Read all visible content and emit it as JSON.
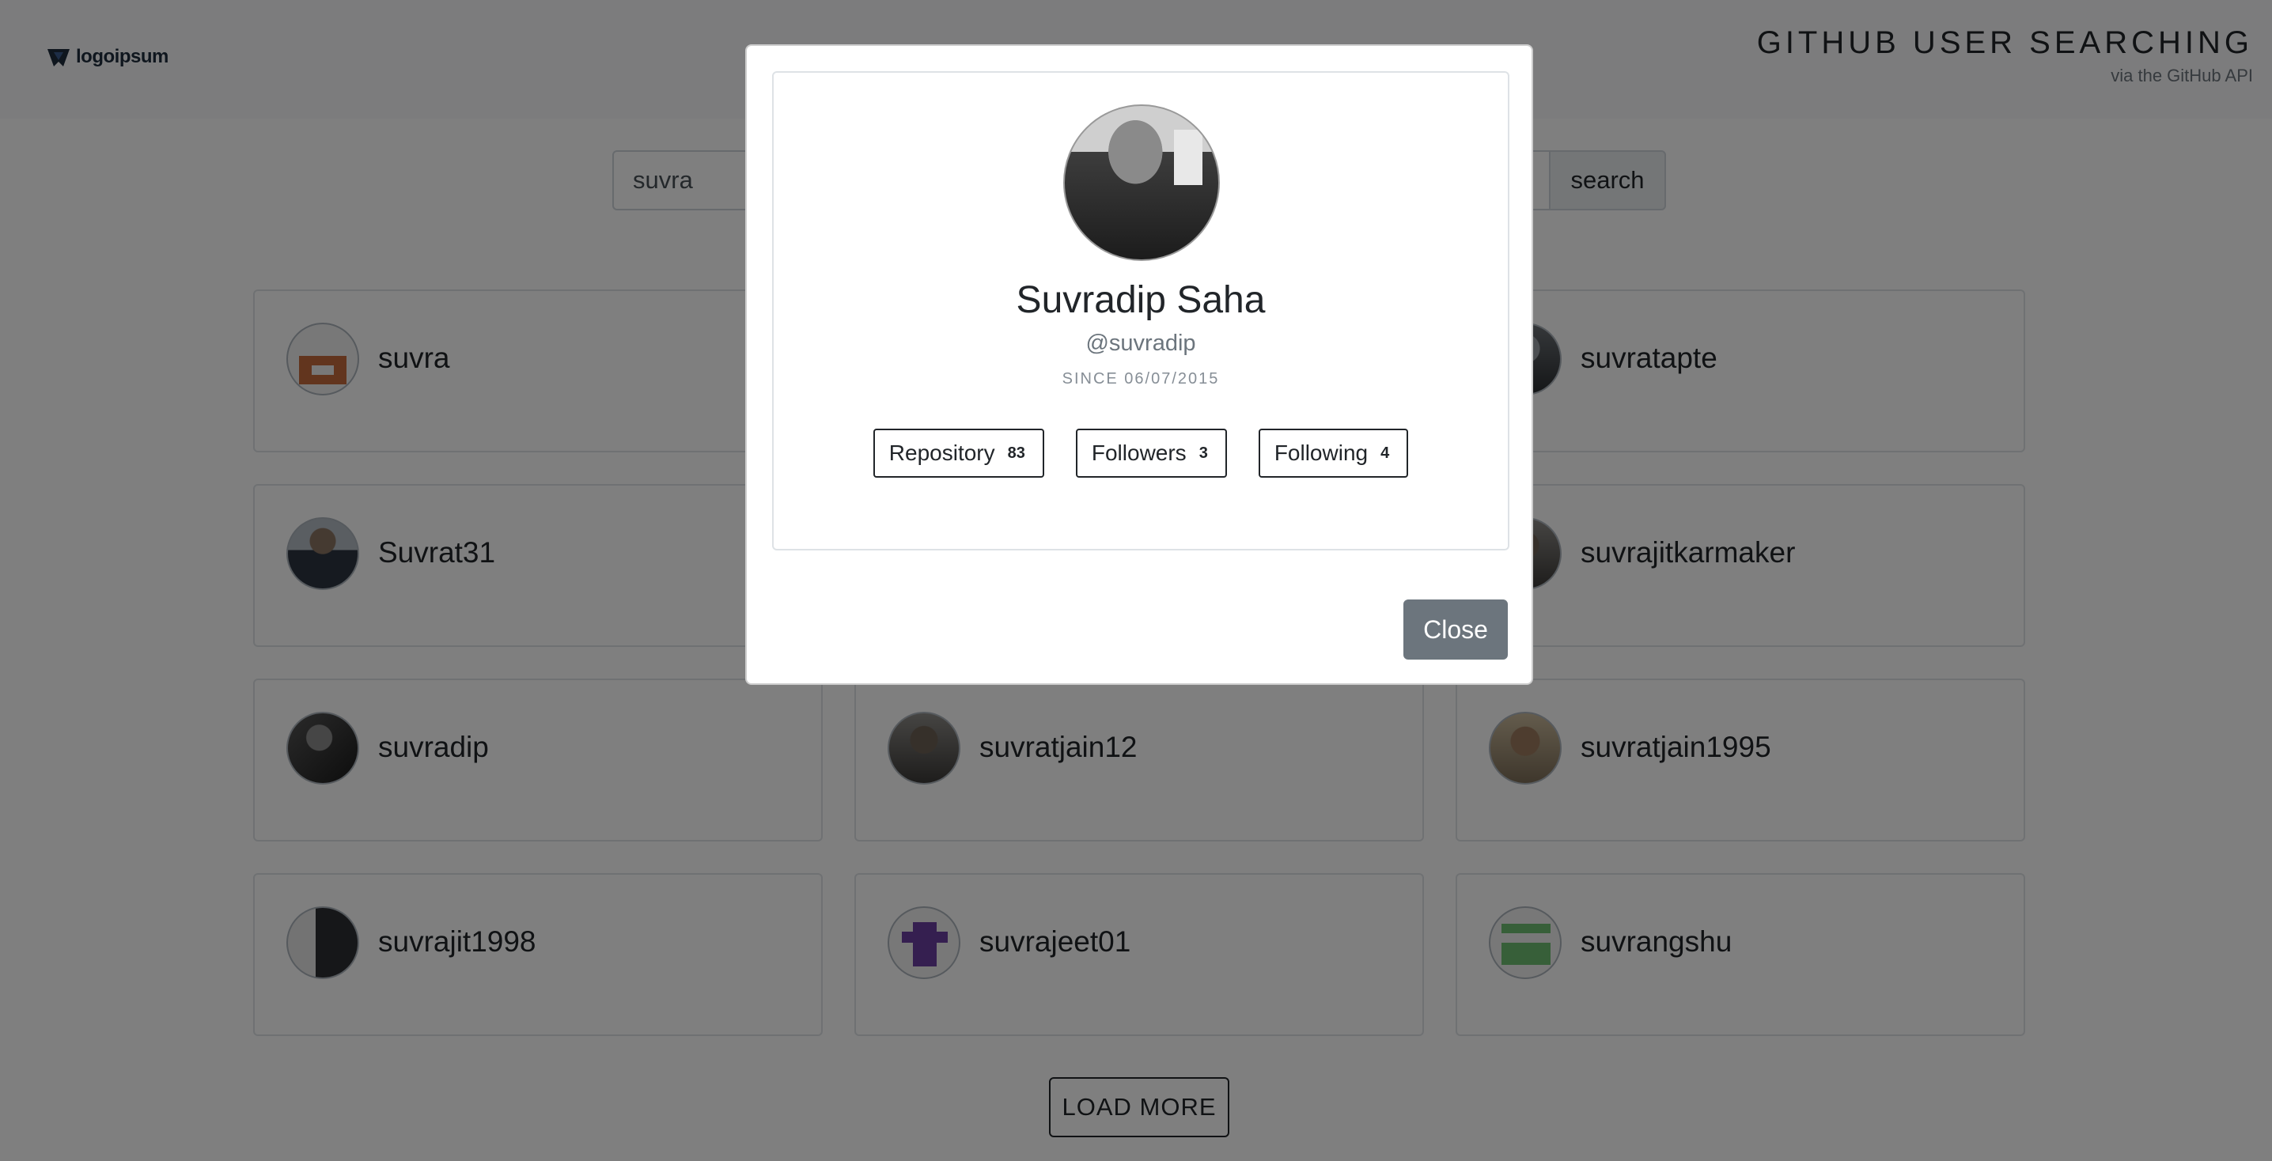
{
  "header": {
    "logo_text": "logoipsum",
    "title": "GITHUB USER SEARCHING",
    "subtitle": "via the GitHub API"
  },
  "search": {
    "value": "suvra",
    "button_label": "search"
  },
  "results": [
    {
      "login": "suvra",
      "avatar": "identicon-orange"
    },
    {
      "login": "",
      "avatar": "hidden"
    },
    {
      "login": "suvratapte",
      "avatar": "photo-dark"
    },
    {
      "login": "Suvrat31",
      "avatar": "photo-suit"
    },
    {
      "login": "",
      "avatar": "hidden"
    },
    {
      "login": "suvrajitkarmaker",
      "avatar": "photo-man"
    },
    {
      "login": "suvradip",
      "avatar": "photo-bw"
    },
    {
      "login": "suvratjain12",
      "avatar": "photo-man"
    },
    {
      "login": "suvratjain1995",
      "avatar": "photo-beard"
    },
    {
      "login": "suvrajit1998",
      "avatar": "photo-split"
    },
    {
      "login": "suvrajeet01",
      "avatar": "identicon-purple"
    },
    {
      "login": "suvrangshu",
      "avatar": "identicon-green"
    }
  ],
  "load_more_label": "LOAD MORE",
  "modal": {
    "name": "Suvradip Saha",
    "handle": "@suvradip",
    "since": "SINCE 06/07/2015",
    "stats": [
      {
        "label": "Repository",
        "count": "83"
      },
      {
        "label": "Followers",
        "count": "3"
      },
      {
        "label": "Following",
        "count": "4"
      }
    ],
    "close_label": "Close"
  }
}
